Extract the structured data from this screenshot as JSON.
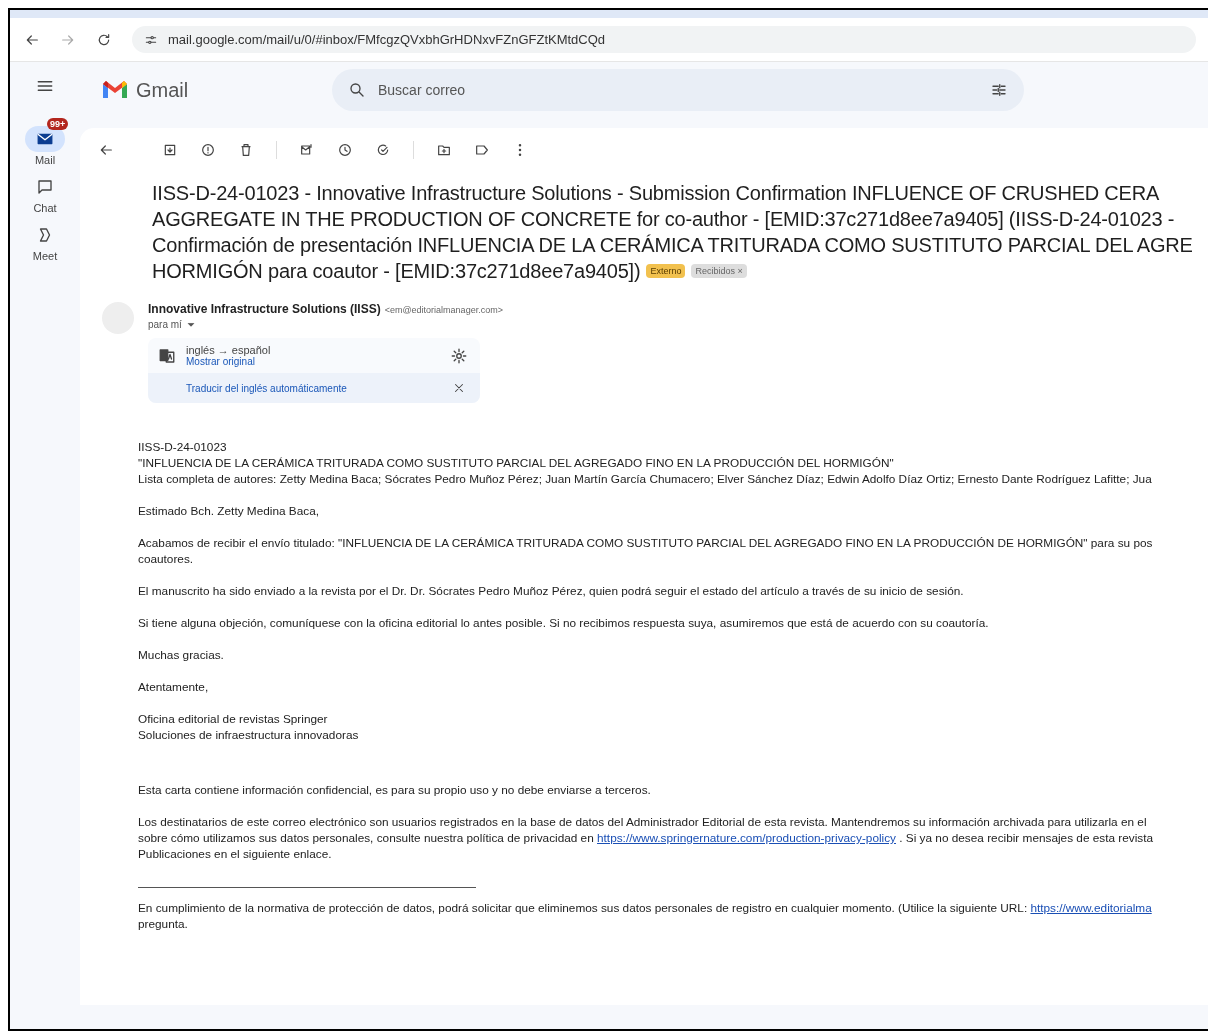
{
  "browser": {
    "url": "mail.google.com/mail/u/0/#inbox/FMfcgzQVxbhGrHDNxvFZnGFZtKMtdCQd"
  },
  "header": {
    "logo": "Gmail",
    "search": {
      "placeholder": "Buscar correo"
    }
  },
  "rail": [
    {
      "label": "Mail",
      "kind": "mail",
      "selected": true,
      "badge": "99+"
    },
    {
      "label": "Chat",
      "kind": "chat",
      "selected": false
    },
    {
      "label": "Meet",
      "kind": "meet",
      "selected": false
    }
  ],
  "subject": {
    "lines": [
      "IISS-D-24-01023 - Innovative Infrastructure Solutions - Submission Confirmation INFLUENCE OF CRUSHED CERA",
      "AGGREGATE IN THE PRODUCTION OF CONCRETE for co-author - [EMID:37c271d8ee7a9405] (IISS-D-24-01023 -",
      "Confirmación de presentación INFLUENCIA DE LA CERÁMICA TRITURADA COMO SUSTITUTO PARCIAL DEL AGRE",
      "HORMIGÓN para coautor - [EMID:37c271d8ee7a9405])"
    ],
    "labels": [
      {
        "text": "Externo",
        "kind": "external"
      },
      {
        "text": "Recibidos ×",
        "kind": "inbox"
      }
    ]
  },
  "sender": {
    "name": "Innovative Infrastructure Solutions (IISS)",
    "email": "<em@editorialmanager.com>",
    "to": "para mí"
  },
  "translation": {
    "languages": "inglés → español",
    "show_original": "Mostrar original",
    "auto_translate": "Traducir del inglés automáticamente"
  },
  "body": [
    {
      "lines": [
        [
          {
            "text": "IISS-D-24-01023"
          }
        ],
        [
          {
            "text": "\"INFLUENCIA DE LA CERÁMICA TRITURADA COMO SUSTITUTO PARCIAL DEL AGREGADO FINO EN LA PRODUCCIÓN DEL HORMIGÓN\""
          }
        ],
        [
          {
            "text": "Lista completa de autores: Zetty Medina Baca; Sócrates Pedro Muñoz Pérez; Juan Martín García Chumacero; Elver Sánchez Díaz; Edwin Adolfo Díaz Ortiz; Ernesto Dante Rodríguez Lafitte; Jua"
          }
        ]
      ]
    },
    {
      "lines": [
        [
          {
            "text": "Estimado Bch. Zetty Medina Baca,"
          }
        ]
      ]
    },
    {
      "lines": [
        [
          {
            "text": "Acabamos de recibir el envío titulado: \"INFLUENCIA DE LA CERÁMICA TRITURADA COMO SUSTITUTO PARCIAL DEL AGREGADO FINO EN LA PRODUCCIÓN DE HORMIGÓN\" para su pos"
          }
        ],
        [
          {
            "text": "coautores."
          }
        ]
      ]
    },
    {
      "lines": [
        [
          {
            "text": "El manuscrito ha sido enviado a la revista por el Dr. Dr. Sócrates Pedro Muñoz Pérez, quien podrá seguir el estado del artículo a través de su inicio de sesión."
          }
        ]
      ]
    },
    {
      "lines": [
        [
          {
            "text": "Si tiene alguna objeción, comuníquese con la oficina editorial lo antes posible. Si no recibimos respuesta suya, asumiremos que está de acuerdo con su coautoría."
          }
        ]
      ]
    },
    {
      "lines": [
        [
          {
            "text": "Muchas gracias."
          }
        ]
      ]
    },
    {
      "lines": [
        [
          {
            "text": "Atentamente,"
          }
        ]
      ]
    },
    {
      "lines": [
        [
          {
            "text": "Oficina editorial de revistas Springer"
          }
        ],
        [
          {
            "text": "Soluciones de infraestructura innovadoras"
          }
        ]
      ],
      "gap_after": true
    },
    {
      "lines": [
        [
          {
            "text": "Esta carta contiene información confidencial, es para su propio uso y no debe enviarse a terceros."
          }
        ]
      ]
    },
    {
      "lines": [
        [
          {
            "text": "Los destinatarios de este correo electrónico son usuarios registrados en la base de datos del Administrador Editorial de esta revista. Mantendremos su información archivada para utilizarla en el"
          }
        ],
        [
          {
            "text": "sobre cómo utilizamos sus datos personales, consulte nuestra política de privacidad en "
          },
          {
            "text": "https://www.springernature.com/production-privacy-policy",
            "link": true
          },
          {
            "text": " . Si ya no desea recibir mensajes de esta revista"
          }
        ],
        [
          {
            "text": "Publicaciones en el siguiente enlace."
          }
        ]
      ],
      "gap_after": true,
      "rule_after": true
    },
    {
      "lines": [
        [
          {
            "text": "En cumplimiento de la normativa de protección de datos, podrá solicitar que eliminemos sus datos personales de registro en cualquier momento. (Utilice la siguiente URL: "
          },
          {
            "text": "https://www.editorialma",
            "link": true
          }
        ],
        [
          {
            "text": "pregunta."
          }
        ]
      ]
    }
  ]
}
